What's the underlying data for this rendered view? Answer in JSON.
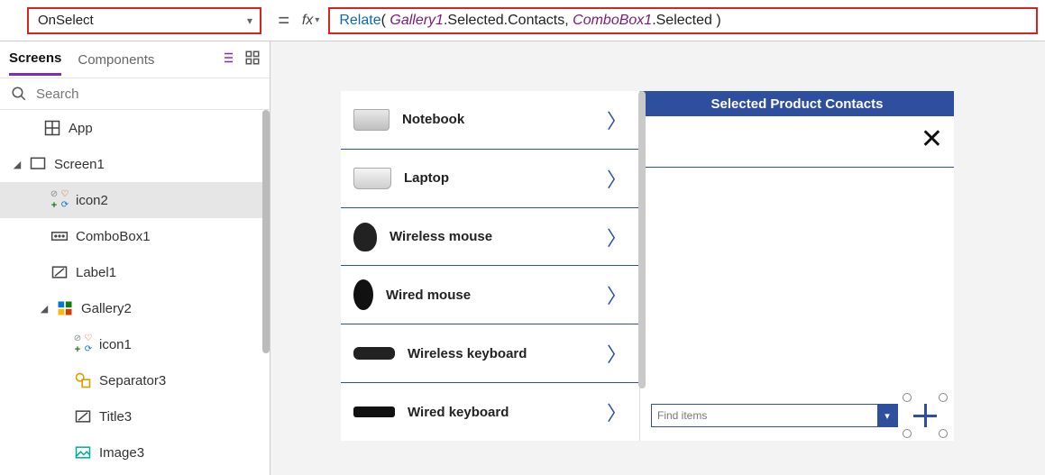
{
  "property": {
    "name": "OnSelect"
  },
  "formula": {
    "tokens": [
      {
        "t": "fn",
        "v": "Relate"
      },
      {
        "t": "plain",
        "v": "( "
      },
      {
        "t": "id",
        "v": "Gallery1"
      },
      {
        "t": "plain",
        "v": ".Selected.Contacts, "
      },
      {
        "t": "id",
        "v": "ComboBox1"
      },
      {
        "t": "plain",
        "v": ".Selected )"
      }
    ]
  },
  "tabs": {
    "screens": "Screens",
    "components": "Components"
  },
  "search": {
    "placeholder": "Search"
  },
  "tree": {
    "app": "App",
    "screen1": "Screen1",
    "icon2": "icon2",
    "combobox1": "ComboBox1",
    "label1": "Label1",
    "gallery2": "Gallery2",
    "icon1": "icon1",
    "separator3": "Separator3",
    "title3": "Title3",
    "image3": "Image3"
  },
  "gallery_items": [
    {
      "label": "Notebook",
      "thumb": "notebook"
    },
    {
      "label": "Laptop",
      "thumb": "laptop"
    },
    {
      "label": "Wireless mouse",
      "thumb": "mouse1"
    },
    {
      "label": "Wired mouse",
      "thumb": "mouse2"
    },
    {
      "label": "Wireless keyboard",
      "thumb": "kb1"
    },
    {
      "label": "Wired keyboard",
      "thumb": "kb2"
    }
  ],
  "rightpanel": {
    "header": "Selected Product Contacts",
    "combo_placeholder": "Find items"
  }
}
